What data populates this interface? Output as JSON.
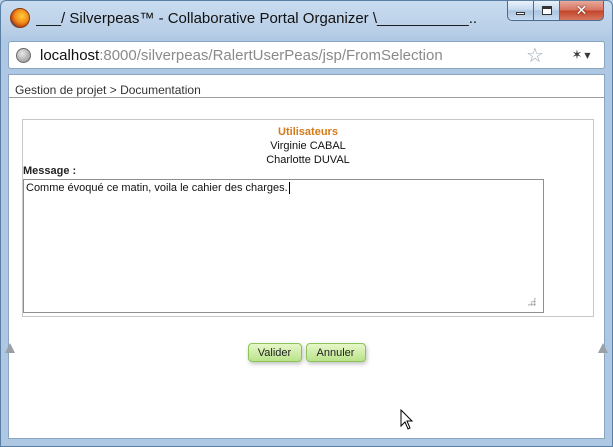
{
  "window": {
    "title": "___/ Silverpeas™ - Collaborative Portal Organizer \\___________...",
    "buttons": {
      "minimize": "minimize",
      "maximize": "maximize",
      "close": "✕"
    }
  },
  "addressbar": {
    "url_host": "localhost",
    "url_rest": ":8000/silverpeas/RalertUserPeas/jsp/FromSelection"
  },
  "breadcrumb": {
    "text": "Gestion de projet > Documentation"
  },
  "recipients": {
    "title": "Utilisateurs",
    "users": [
      "Virginie CABAL",
      "Charlotte DUVAL"
    ]
  },
  "message": {
    "label": "Message :",
    "value": "Comme évoqué ce matin, voila le cahier des charges."
  },
  "actions": {
    "validate": "Valider",
    "cancel": "Annuler"
  },
  "colors": {
    "section_title": "#d47a19",
    "button_bg": "#b9e38a"
  }
}
